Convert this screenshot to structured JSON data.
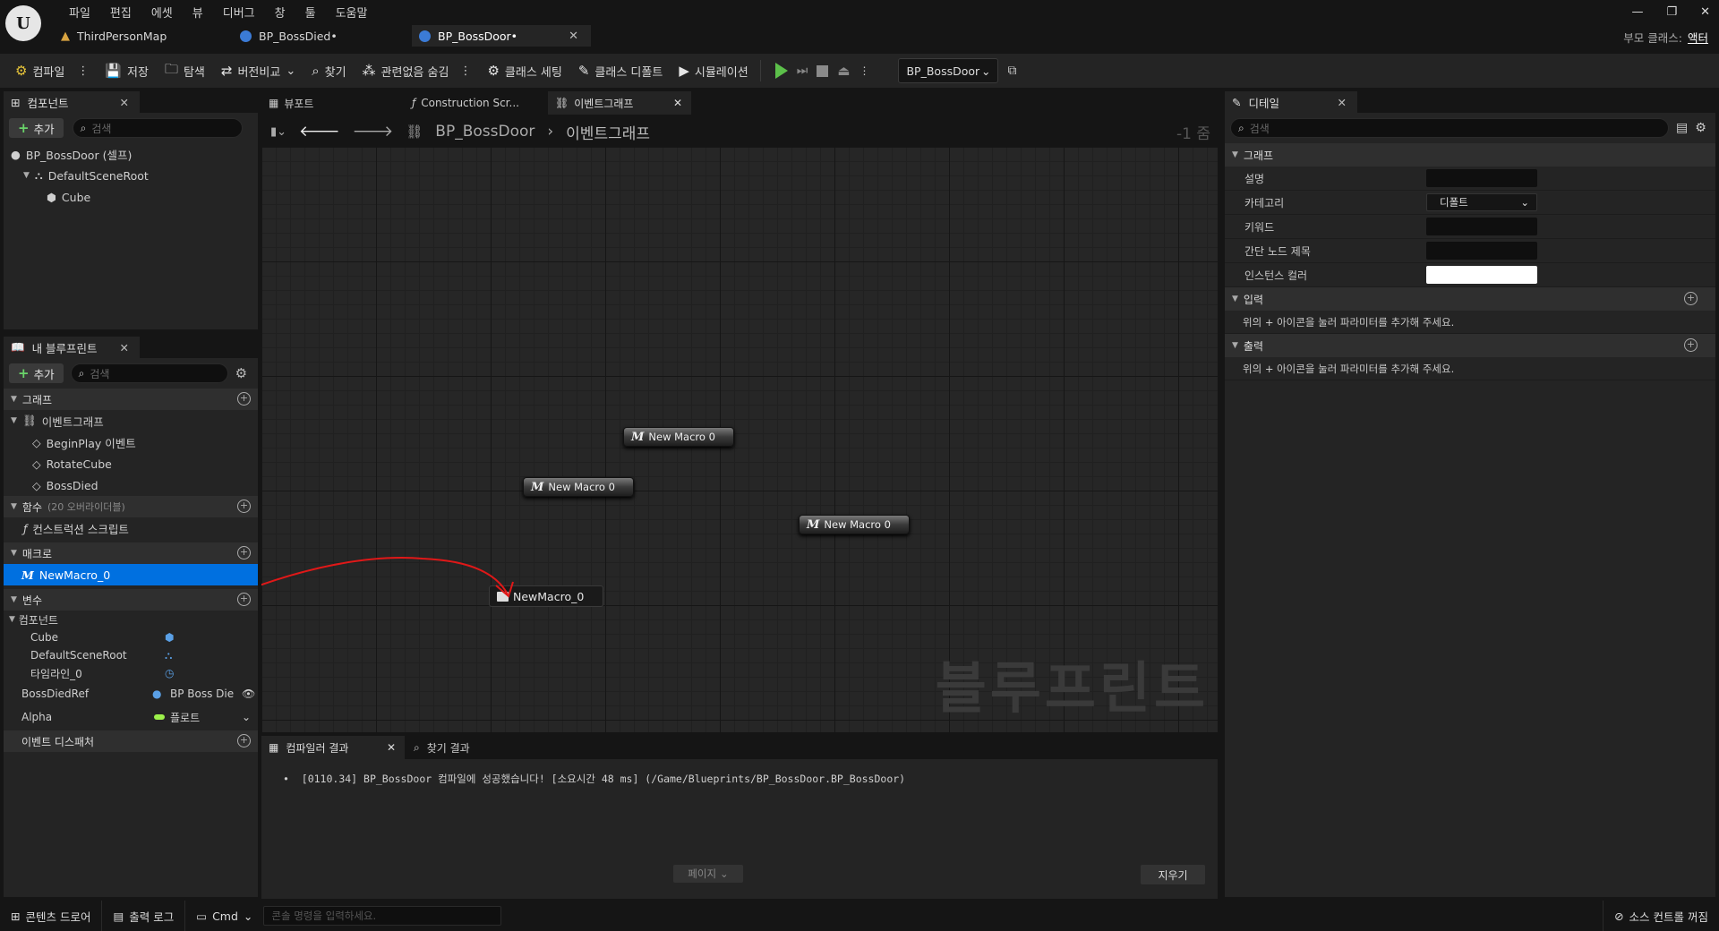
{
  "menu": [
    "파일",
    "편집",
    "에셋",
    "뷰",
    "디버그",
    "창",
    "툴",
    "도움말"
  ],
  "doc_tabs": [
    {
      "label": "ThirdPersonMap",
      "active": false
    },
    {
      "label": "BP_BossDied•",
      "active": false
    },
    {
      "label": "BP_BossDoor•",
      "active": true
    }
  ],
  "parent_class": {
    "label": "부모 클래스:",
    "value": "액터"
  },
  "toolbar": {
    "compile": "컴파일",
    "save": "저장",
    "browse": "탐색",
    "diff": "버전비교",
    "find": "찾기",
    "hide_unrelated": "관련없음 숨김",
    "class_settings": "클래스 세팅",
    "class_defaults": "클래스 디폴트",
    "simulation": "시뮬레이션",
    "debug_object": "BP_BossDoor"
  },
  "components_panel": {
    "title": "컴포넌트",
    "add": "추가",
    "search_placeholder": "검색",
    "tree": [
      "BP_BossDoor (셀프)",
      "DefaultSceneRoot",
      "Cube"
    ]
  },
  "my_blueprint": {
    "title": "내 블루프린트",
    "add": "추가",
    "search_placeholder": "검색",
    "graphs_cat": "그래프",
    "event_graph": "이벤트그래프",
    "events": [
      "BeginPlay 이벤트",
      "RotateCube",
      "BossDied"
    ],
    "functions_cat": "함수",
    "functions_note": "(20 오버라이더블)",
    "construction": "컨스트럭션 스크립트",
    "macros_cat": "매크로",
    "macro_item": "NewMacro_0",
    "variables_cat": "변수",
    "components_sub": "컴포넌트",
    "components": [
      "Cube",
      "DefaultSceneRoot",
      "타임라인_0"
    ],
    "vars": [
      {
        "name": "BossDiedRef",
        "type": "BP Boss Die"
      },
      {
        "name": "Alpha",
        "type": "플로트"
      }
    ],
    "dispatchers_cat": "이벤트 디스패처"
  },
  "graph_tabs": [
    {
      "label": "뷰포트"
    },
    {
      "label": "Construction Scr..."
    },
    {
      "label": "이벤트그래프"
    }
  ],
  "breadcrumb": {
    "root": "BP_BossDoor",
    "current": "이벤트그래프",
    "zoom": "-1 줌"
  },
  "graph": {
    "macro_nodes": [
      "New Macro 0",
      "New Macro 0",
      "New Macro 0"
    ],
    "tunnel_node": "NewMacro_0",
    "watermark": "블루프린트"
  },
  "compiler": {
    "tab_results": "컴파일러 결과",
    "tab_find": "찾기 결과",
    "message": "[0110.34] BP_BossDoor 컴파일에 성공했습니다! [소요시간 48 ms] (/Game/Blueprints/BP_BossDoor.BP_BossDoor)",
    "page": "페이지",
    "clear": "지우기"
  },
  "details": {
    "title": "디테일",
    "search_placeholder": "검색",
    "graph_cat": "그래프",
    "rows": [
      "설명",
      "카테고리",
      "키워드",
      "간단 노드 제목",
      "인스턴스 컬러"
    ],
    "category_value": "디폴트",
    "inputs_cat": "입력",
    "inputs_hint": "위의 + 아이콘을 눌러 파라미터를 추가해 주세요.",
    "outputs_cat": "출력",
    "outputs_hint": "위의 + 아이콘을 눌러 파라미터를 추가해 주세요."
  },
  "statusbar": {
    "content_drawer": "콘텐츠 드로어",
    "output_log": "출력 로그",
    "cmd": "Cmd",
    "console_placeholder": "콘솔 명령을 입력하세요.",
    "source_control": "소스 컨트롤 꺼짐"
  },
  "colors": {
    "accent": "#0e6fd6",
    "play": "#5cc04a",
    "selection": "#0070e0"
  }
}
